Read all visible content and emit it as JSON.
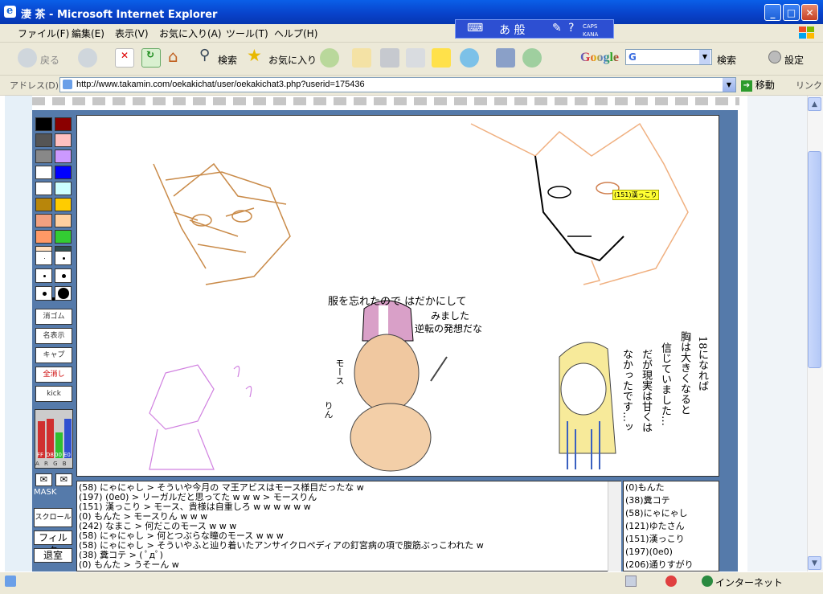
{
  "window": {
    "title": "淒 茶 - Microsoft Internet Explorer",
    "app_icon_glyph": "e"
  },
  "ime": {
    "mode": "あ 般",
    "caps": "CAPS",
    "kana": "KANA"
  },
  "menu": [
    "ファイル(F)",
    "編集(E)",
    "表示(V)",
    "お気に入り(A)",
    "ツール(T)",
    "ヘルプ(H)"
  ],
  "toolbar": {
    "back": "戻る",
    "search": "検索",
    "favorites": "お気に入り",
    "google_logo": "Google",
    "google_g": "G",
    "google_search": "検索",
    "settings": "設定"
  },
  "address": {
    "label": "アドレス(D)",
    "url": "http://www.takamin.com/oekakichat/user/oekakichat3.php?userid=175436",
    "go": "移動",
    "links": "リンク"
  },
  "palette": {
    "colors": [
      "#000000",
      "#8b0000",
      "#555555",
      "#ffc0c0",
      "#888888",
      "#cc99ff",
      "#ffffff",
      "#0000ff",
      "#ffffff",
      "#ccffff",
      "#b8860b",
      "#ffcc00",
      "#f0a080",
      "#ffd0a0",
      "#ff9966",
      "#33cc33",
      "#ffe0c0",
      "#2f4f4f"
    ],
    "tools": [
      "消ゴム",
      "名表示",
      "キャプ",
      "全消し",
      "kick"
    ],
    "meter_labels": [
      "FF",
      "D8",
      "00",
      "E0"
    ],
    "meter_fill": [
      0.8,
      0.85,
      0.55,
      0.85
    ],
    "meter_axis": "A R G B",
    "mask_label": "MASK",
    "scroll_btn": "スクロール",
    "filter_btn": "フィルタ",
    "exit_btn": "退室"
  },
  "canvas": {
    "name_tag": "(151)漢っこり",
    "texts": [
      "服を忘れたので はだかにして",
      "みました",
      "逆転の発想だな",
      "モース",
      "りん",
      "18になれば",
      "胸は大きくなると",
      "信じていました…",
      "だが現実は甘くは",
      "なかったです…ッ"
    ]
  },
  "chat": [
    "(58) にゃにゃし > そういや今月の マ王アビスはモース様目だったな w",
    "(197) (0e0) > リーガルだと思ってた w w w > モースりん",
    "(151) 漢っこり > モース、貴様は自重しろ w w w w w w",
    "(0) もんた > モースりん w w w",
    "(242) なまこ > 何だこのモース w w w",
    "(58) にゃにゃし > 何とつぶらな瞳のモース w w w",
    "(58) にゃにゃし > そういやふと辿り着いたアンサイクロペディアの釘宮病の項で腹筋ぶっこわれた w",
    "(38) 糞コテ > ( ﾟдﾟ)",
    "(0) もんた > うそーん w"
  ],
  "users": [
    "(0)もんた",
    "(38)糞コテ",
    "(58)にゃにゃし",
    "(121)ゆたさん",
    "(151)漢っこり",
    "(197)(0e0)",
    "(206)通りすがり"
  ],
  "statusbar": {
    "zone": "インターネット"
  }
}
